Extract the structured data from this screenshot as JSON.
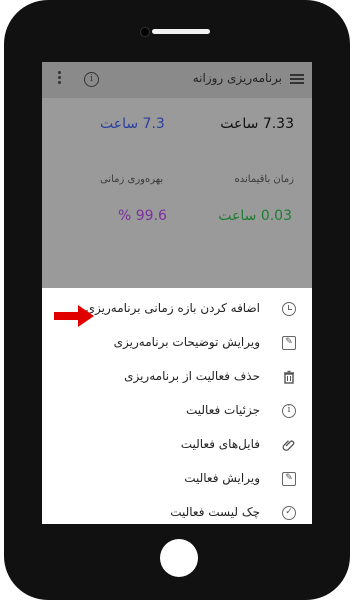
{
  "app": {
    "title": "برنامه‌ریزی روزانه",
    "info_glyph": "i"
  },
  "stats": {
    "total_time": "7.33 ساعت",
    "planned_time": "7.3 ساعت",
    "remaining_label": "زمان باقیمانده",
    "productivity_label": "بهره‌وری زمانی",
    "remaining_value": "0.03 ساعت",
    "productivity_value": "99.6 %"
  },
  "colors": {
    "planned": "#2a3f9e",
    "remaining": "#1e7d32",
    "productivity": "#7b2fa0",
    "arrow": "#e00000"
  },
  "menu": {
    "items": [
      {
        "label": "اضافه کردن بازه زمانی برنامه‌ریزی",
        "icon": "clock-icon"
      },
      {
        "label": "ویرایش توضیحات برنامه‌ریزی",
        "icon": "edit-icon"
      },
      {
        "label": "حذف فعالیت از برنامه‌ریزی",
        "icon": "trash-icon"
      },
      {
        "label": "جزئیات فعالیت",
        "icon": "info-icon"
      },
      {
        "label": "فایل‌های فعالیت",
        "icon": "paperclip-icon"
      },
      {
        "label": "ویرایش فعالیت",
        "icon": "edit-icon"
      },
      {
        "label": "چک لیست فعالیت",
        "icon": "check-circle-icon"
      }
    ]
  }
}
